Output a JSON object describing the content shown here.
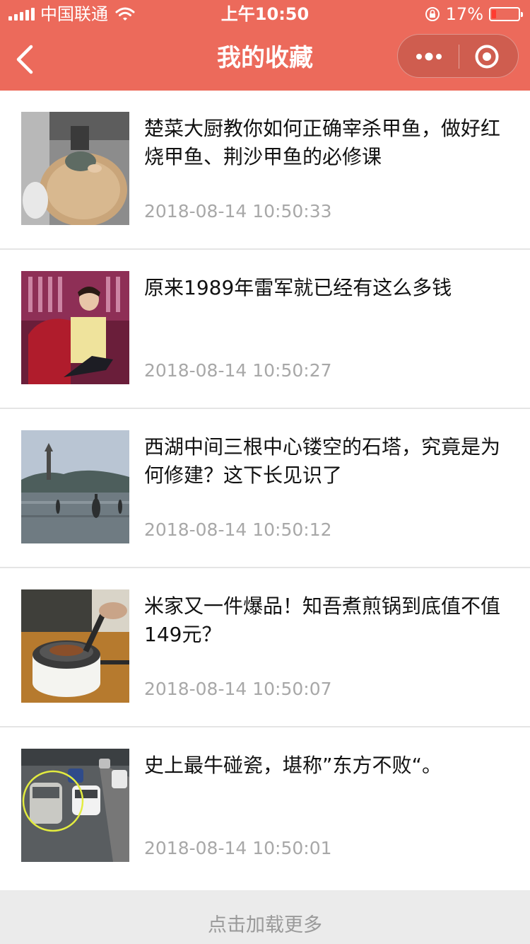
{
  "status_bar": {
    "carrier": "中国联通",
    "time": "上午10:50",
    "battery_text": "17%",
    "battery_level": 0.17
  },
  "navbar": {
    "title": "我的收藏",
    "back_icon": "chevron-left-icon",
    "more_icon": "more-dots-icon",
    "close_icon": "target-circle-icon"
  },
  "items": [
    {
      "title": "楚菜大厨教你如何正确宰杀甲鱼，做好红烧甲鱼、荆沙甲鱼的必修课",
      "date": "2018-08-14 10:50:33",
      "thumb": "cooking-turtle-thumbnail"
    },
    {
      "title": "原来1989年雷军就已经有这么多钱",
      "date": "2018-08-14 10:50:27",
      "thumb": "tv-interview-thumbnail"
    },
    {
      "title": "西湖中间三根中心镂空的石塔，究竟是为何修建？这下长见识了",
      "date": "2018-08-14 10:50:12",
      "thumb": "west-lake-pagoda-thumbnail"
    },
    {
      "title": "米家又一件爆品！知吾煮煎锅到底值不值149元？",
      "date": "2018-08-14 10:50:07",
      "thumb": "cooking-pot-thumbnail"
    },
    {
      "title": "史上最牛碰瓷，堪称”东方不败“。",
      "date": "2018-08-14 10:50:01",
      "thumb": "traffic-accident-thumbnail"
    }
  ],
  "load_more": {
    "label": "点击加载更多"
  },
  "colors": {
    "header": "#ec6a5b",
    "date_text": "#a8a8a8",
    "divider": "#e5e5e5"
  }
}
